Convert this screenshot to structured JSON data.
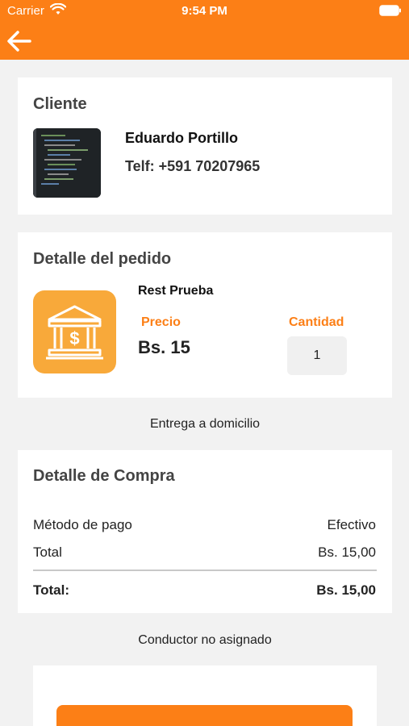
{
  "status_bar": {
    "carrier": "Carrier",
    "time": "9:54 PM"
  },
  "nav": {
    "back_icon": "arrow-left-icon"
  },
  "client_section": {
    "title": "Cliente",
    "name": "Eduardo Portillo",
    "phone": "Telf: +591 70207965"
  },
  "order_section": {
    "title": "Detalle del pedido",
    "product_name": "Rest Prueba",
    "price_label": "Precio",
    "price_value": "Bs. 15",
    "quantity_label": "Cantidad",
    "quantity_value": "1",
    "product_icon": "bank-dollar-icon"
  },
  "delivery": {
    "label": "Entrega a domicilio"
  },
  "purchase_section": {
    "title": "Detalle de Compra",
    "rows": [
      {
        "label": "Método de pago",
        "value": "Efectivo"
      },
      {
        "label": "Total",
        "value": "Bs. 15,00"
      }
    ],
    "grand_total_label": "Total:",
    "grand_total_value": "Bs. 15,00"
  },
  "driver": {
    "status": "Conductor no asignado"
  },
  "colors": {
    "accent": "#fc7f16",
    "icon_bg": "#f8a93a",
    "band": "#f2f2f2"
  }
}
